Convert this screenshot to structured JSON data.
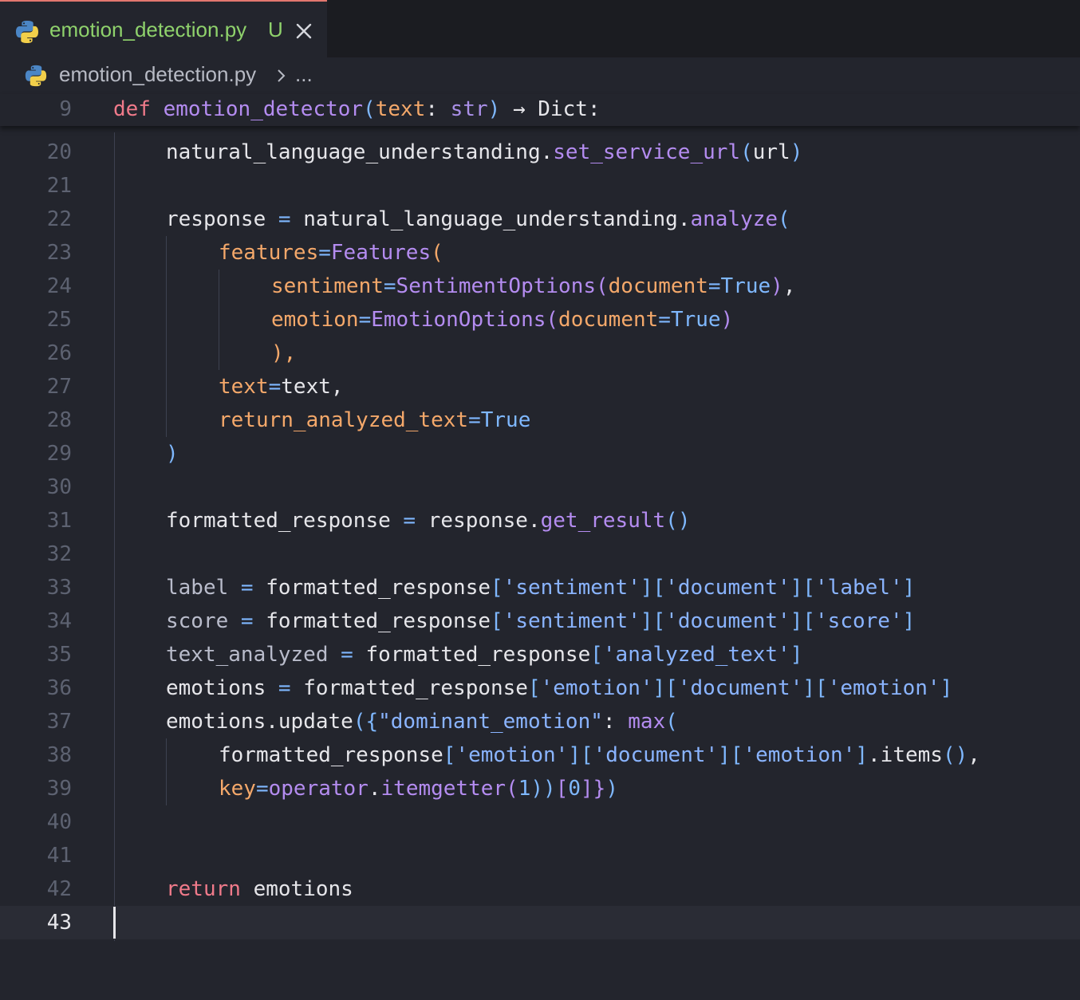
{
  "tab": {
    "file_name": "emotion_detection.py",
    "status": "U",
    "close": "×"
  },
  "breadcrumb": {
    "file_name": "emotion_detection.py",
    "more": "..."
  },
  "sticky_line": {
    "number": "9",
    "kw": "def",
    "name": "emotion_detector",
    "params": "text",
    "type": "str",
    "return_type": "Dict"
  },
  "lines": [
    {
      "number": "20"
    },
    {
      "number": "21"
    },
    {
      "number": "22"
    },
    {
      "number": "23"
    },
    {
      "number": "24"
    },
    {
      "number": "25"
    },
    {
      "number": "26"
    },
    {
      "number": "27"
    },
    {
      "number": "28"
    },
    {
      "number": "29"
    },
    {
      "number": "30"
    },
    {
      "number": "31"
    },
    {
      "number": "32"
    },
    {
      "number": "33"
    },
    {
      "number": "34"
    },
    {
      "number": "35"
    },
    {
      "number": "36"
    },
    {
      "number": "37"
    },
    {
      "number": "38"
    },
    {
      "number": "39"
    },
    {
      "number": "40"
    },
    {
      "number": "41"
    },
    {
      "number": "42"
    },
    {
      "number": "43"
    }
  ],
  "code": {
    "l20": [
      "natural_language_understanding",
      ".",
      "set_service_url",
      "(",
      "url",
      ")"
    ],
    "l22": [
      "response",
      " = ",
      "natural_language_understanding",
      ".",
      "analyze",
      "("
    ],
    "l23": [
      "features",
      "=",
      "Features",
      "("
    ],
    "l24": [
      "sentiment",
      "=",
      "SentimentOptions",
      "(",
      "document",
      "=",
      "True",
      ")",
      ","
    ],
    "l25": [
      "emotion",
      "=",
      "EmotionOptions",
      "(",
      "document",
      "=",
      "True",
      ")"
    ],
    "l26": [
      "),"
    ],
    "l27": [
      "text",
      "=",
      "text",
      ","
    ],
    "l28": [
      "return_analyzed_text",
      "=",
      "True"
    ],
    "l29": [
      ")"
    ],
    "l31": [
      "formatted_response",
      " = ",
      "response",
      ".",
      "get_result",
      "()"
    ],
    "l33": [
      "label",
      " = ",
      "formatted_response",
      "[",
      "'sentiment'",
      "][",
      "'document'",
      "][",
      "'label'",
      "]"
    ],
    "l34": [
      "score",
      " = ",
      "formatted_response",
      "[",
      "'sentiment'",
      "][",
      "'document'",
      "][",
      "'score'",
      "]"
    ],
    "l35": [
      "text_analyzed",
      " = ",
      "formatted_response",
      "[",
      "'analyzed_text'",
      "]"
    ],
    "l36": [
      "emotions",
      " = ",
      "formatted_response",
      "[",
      "'emotion'",
      "][",
      "'document'",
      "][",
      "'emotion'",
      "]"
    ],
    "l37": [
      "emotions",
      ".update",
      "({",
      "\"dominant_emotion\"",
      ": ",
      "max",
      "("
    ],
    "l38": [
      "formatted_response",
      "[",
      "'emotion'",
      "][",
      "'document'",
      "][",
      "'emotion'",
      "]",
      ".items",
      "()",
      ","
    ],
    "l39": [
      "key",
      "=",
      "operator",
      ".",
      "itemgetter",
      "(",
      "1",
      "))",
      "[",
      "0",
      "]}",
      ")"
    ],
    "l42": [
      "return",
      " emotions"
    ]
  },
  "colors": {
    "background": "#23252d",
    "tab_accent": "#e3776f",
    "modified_green": "#8fd26c"
  }
}
